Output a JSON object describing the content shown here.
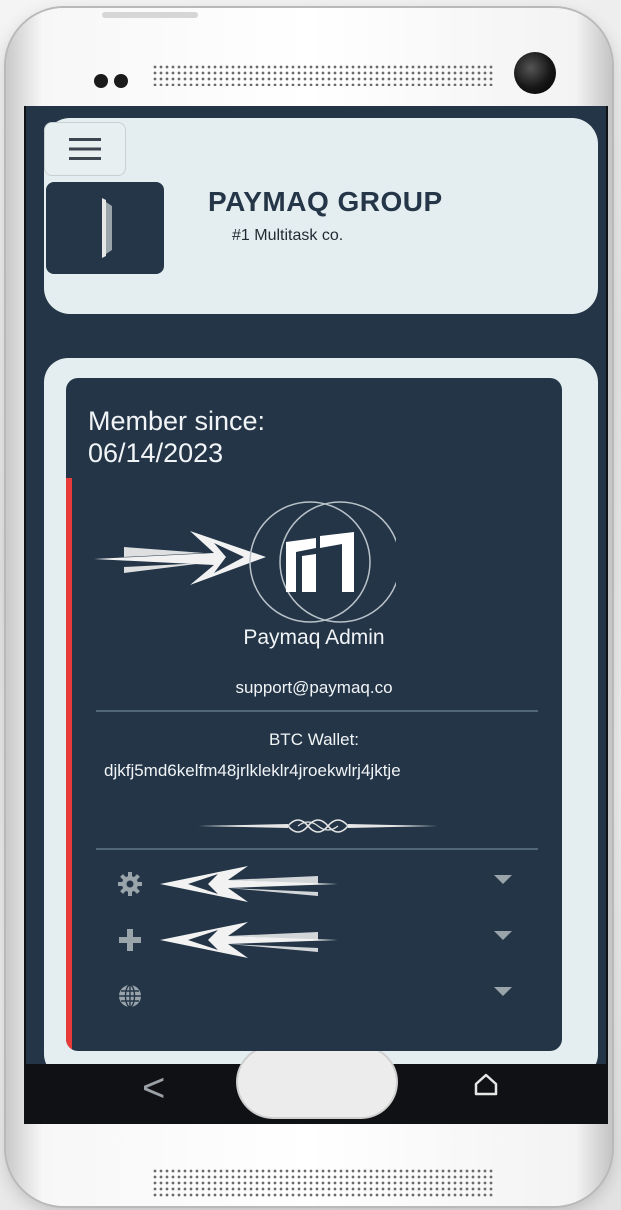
{
  "header": {
    "brand_title": "PAYMAQ GROUP",
    "brand_subtitle": "#1 Multitask co."
  },
  "profile": {
    "member_since_label": "Member since:",
    "member_since_date": "06/14/2023",
    "name": "Paymaq Admin",
    "email": "support@paymaq.co",
    "btc_label": "BTC Wallet:",
    "btc_address": "djkfj5md6kelfm48jrlkleklr4jroekwlrj4jktje"
  },
  "menu_rows": [
    {
      "icon": "gear-icon"
    },
    {
      "icon": "plus-icon"
    },
    {
      "icon": "globe-icon"
    }
  ],
  "colors": {
    "navy": "#233547",
    "card_bg": "#e4eef0",
    "accent_red": "#e93a3a",
    "text_light": "#f1f4f6"
  },
  "nav": {
    "back_glyph": "<"
  }
}
